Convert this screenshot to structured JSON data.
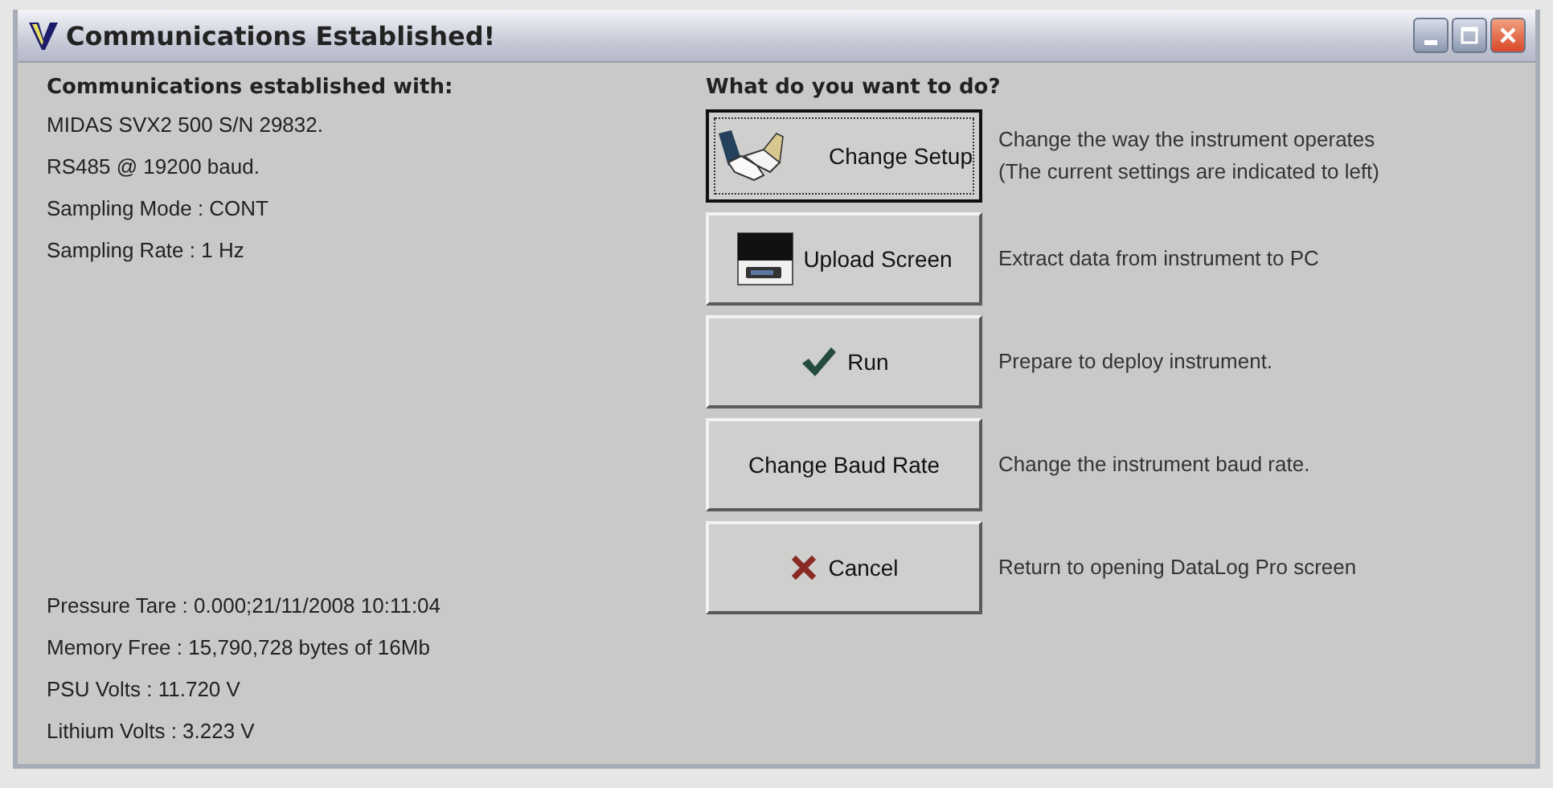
{
  "window": {
    "title": "Communications Established!"
  },
  "connection": {
    "heading": "Communications established with:",
    "lines": [
      "MIDAS SVX2 500 S/N 29832.",
      "RS485 @ 19200 baud.",
      "Sampling Mode : CONT",
      "Sampling Rate : 1 Hz"
    ]
  },
  "status": [
    "Pressure Tare : 0.000;21/11/2008 10:11:04",
    "Memory Free : 15,790,728 bytes of 16Mb",
    "PSU Volts : 11.720 V",
    "Lithium Volts : 3.223 V"
  ],
  "actions": {
    "heading": "What do you want to do?",
    "items": [
      {
        "kind": "setup",
        "label": "Change Setup",
        "focused": true,
        "description": [
          "Change the way the instrument operates",
          "(The current settings are indicated to left)"
        ]
      },
      {
        "kind": "upload",
        "label": "Upload Screen",
        "focused": false,
        "description": [
          "Extract data from instrument to PC"
        ]
      },
      {
        "kind": "run",
        "label": "Run",
        "focused": false,
        "description": [
          "Prepare to deploy instrument."
        ]
      },
      {
        "kind": "plain",
        "label": "Change Baud Rate",
        "focused": false,
        "description": [
          "Change the instrument baud rate."
        ]
      },
      {
        "kind": "cancel",
        "label": "Cancel",
        "focused": false,
        "description": [
          "Return to opening DataLog Pro screen"
        ]
      }
    ]
  }
}
